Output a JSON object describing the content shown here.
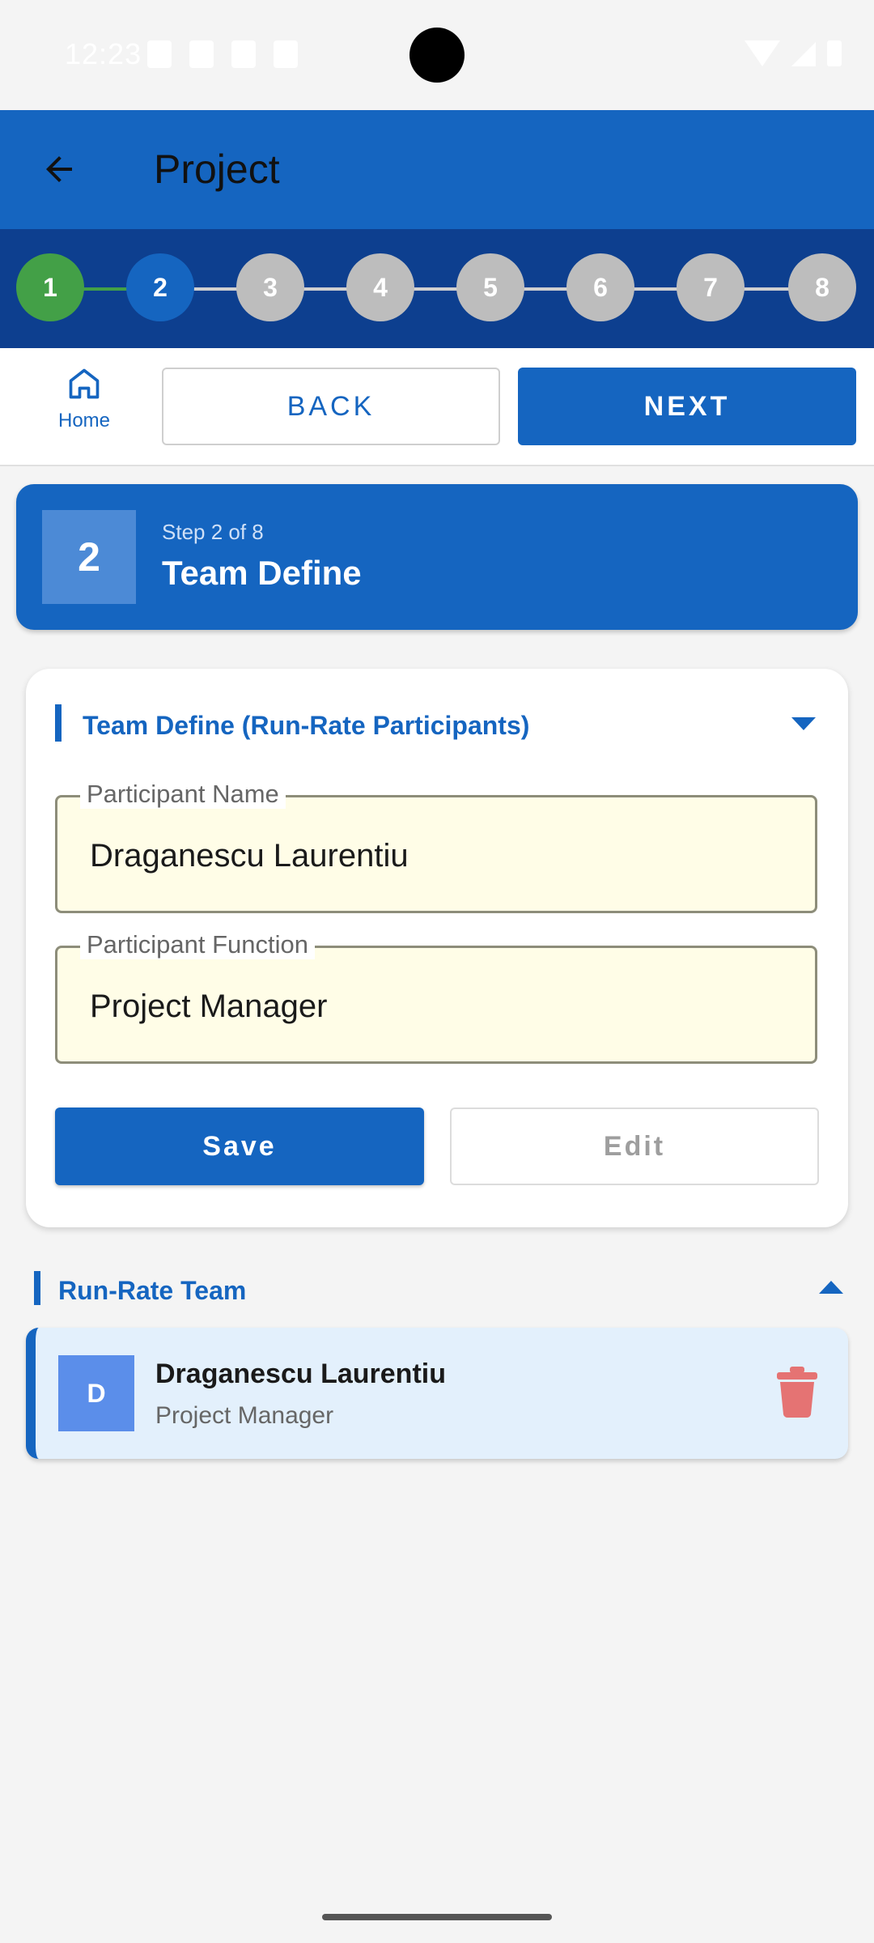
{
  "status_bar": {
    "time": "12:23"
  },
  "app_bar": {
    "title": "Project",
    "background": "#1565c0"
  },
  "stepper": {
    "steps": [
      "1",
      "2",
      "3",
      "4",
      "5",
      "6",
      "7",
      "8"
    ],
    "completed_color": "#43a047",
    "current_color": "#1565c0",
    "pending_color": "#bdbdbd"
  },
  "actions": {
    "home_label": "Home",
    "back_label": "BACK",
    "next_label": "NEXT"
  },
  "step_header": {
    "number": "2",
    "count_text": "Step 2 of 8",
    "title": "Team Define"
  },
  "form": {
    "section_title": "Team Define (Run-Rate Participants)",
    "name_label": "Participant Name",
    "name_value": "Draganescu Laurentiu",
    "function_label": "Participant Function",
    "function_value": "Project Manager",
    "save_label": "Save",
    "edit_label": "Edit"
  },
  "team": {
    "section_title": "Run-Rate Team",
    "members": [
      {
        "initial": "D",
        "name": "Draganescu Laurentiu",
        "role": "Project Manager"
      }
    ]
  }
}
